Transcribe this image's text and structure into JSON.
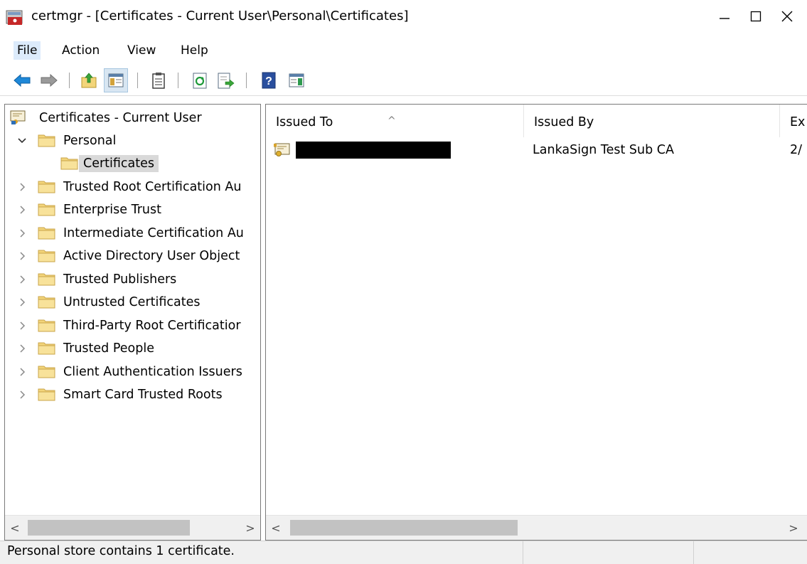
{
  "window": {
    "title": "certmgr - [Certificates - Current User\\Personal\\Certificates]",
    "minimize_glyph": "—",
    "maximize_glyph": "☐",
    "close_glyph": "✕"
  },
  "menu": [
    {
      "label": "File",
      "active": true
    },
    {
      "label": "Action",
      "active": false
    },
    {
      "label": "View",
      "active": false
    },
    {
      "label": "Help",
      "active": false
    }
  ],
  "toolbar": {
    "icons": [
      "back-arrow-icon",
      "forward-arrow-icon",
      "up-one-level-icon",
      "show-hide-console-tree-icon",
      "properties-icon",
      "refresh-icon",
      "export-list-icon",
      "help-icon",
      "show-hide-action-pane-icon"
    ]
  },
  "tree": {
    "root": "Certificates - Current User",
    "items": [
      {
        "label": "Personal",
        "expanded": true
      },
      {
        "label": "Certificates",
        "selected": true,
        "child": true
      },
      {
        "label": "Trusted Root Certification Au"
      },
      {
        "label": "Enterprise Trust"
      },
      {
        "label": "Intermediate Certification Au"
      },
      {
        "label": "Active Directory User Object"
      },
      {
        "label": "Trusted Publishers"
      },
      {
        "label": "Untrusted Certificates"
      },
      {
        "label": "Third-Party Root Certificatior"
      },
      {
        "label": "Trusted People"
      },
      {
        "label": "Client Authentication Issuers"
      },
      {
        "label": "Smart Card Trusted Roots"
      }
    ]
  },
  "list": {
    "columns": [
      "Issued To",
      "Issued By",
      "Ex"
    ],
    "rows": [
      {
        "issued_to": "",
        "issued_by": "LankaSign Test Sub CA",
        "expiration": "2/"
      }
    ]
  },
  "scroll": {
    "left_glyph": "<",
    "right_glyph": ">"
  },
  "status": {
    "text": "Personal store contains 1 certificate."
  },
  "colors": {
    "folder": "#f3d57a",
    "accent_blue": "#1e88d8",
    "menu_active": "#dcebfb"
  }
}
